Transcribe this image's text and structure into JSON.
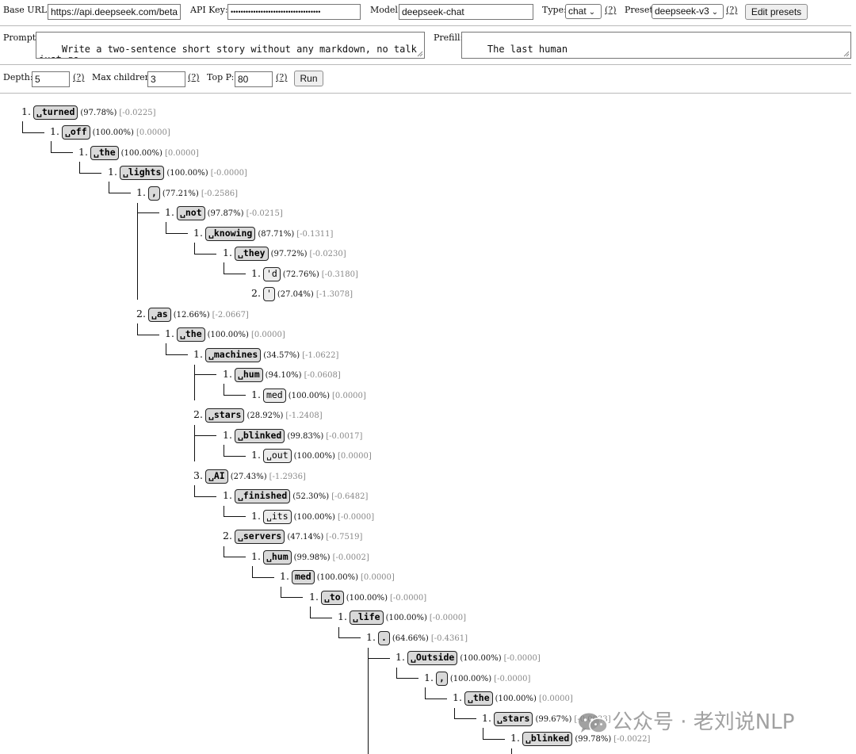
{
  "toolbar": {
    "base_url_label": "Base URL:",
    "base_url_value": "https://api.deepseek.com/beta",
    "api_key_label": "API Key:",
    "api_key_value": "••••••••••••••••••••••••••••••••••••",
    "model_label": "Model:",
    "model_value": "deepseek-chat",
    "type_label": "Type:",
    "type_value": "chat",
    "help_text": "(?)",
    "preset_label": "Preset:",
    "preset_value": "deepseek-v3",
    "edit_presets_label": "Edit presets"
  },
  "prompt_row": {
    "prompt_label": "Prompt:",
    "prompt_value": "Write a two-sentence short story without any markdown, no talk\njust go.",
    "prefill_label": "Prefill:",
    "prefill_value": "The last human"
  },
  "params": {
    "depth_label": "Depth:",
    "depth_value": "5",
    "max_children_label": "Max children:",
    "max_children_value": "3",
    "top_p_label": "Top P:",
    "top_p_value": "80",
    "help_text": "(?)",
    "run_label": "Run"
  },
  "tree": {
    "nodes": [
      {
        "rank": "1.",
        "token": "␣turned",
        "prob": "(97.78%)",
        "logprob": "[-0.0225]",
        "bold": true
      },
      {
        "rank": "1.",
        "token": "␣off",
        "prob": "(100.00%)",
        "logprob": "[0.0000]",
        "bold": true
      },
      {
        "rank": "1.",
        "token": "␣the",
        "prob": "(100.00%)",
        "logprob": "[0.0000]",
        "bold": true
      },
      {
        "rank": "1.",
        "token": "␣lights",
        "prob": "(100.00%)",
        "logprob": "[-0.0000]",
        "bold": true
      },
      {
        "rank": "1.",
        "token": ",",
        "prob": "(77.21%)",
        "logprob": "[-0.2586]",
        "bold": true
      },
      {
        "rank": "1.",
        "token": "␣not",
        "prob": "(97.87%)",
        "logprob": "[-0.0215]",
        "bold": true
      },
      {
        "rank": "1.",
        "token": "␣knowing",
        "prob": "(87.71%)",
        "logprob": "[-0.1311]",
        "bold": true
      },
      {
        "rank": "1.",
        "token": "␣they",
        "prob": "(97.72%)",
        "logprob": "[-0.0230]",
        "bold": true
      },
      {
        "rank": "1.",
        "token": "'d",
        "prob": "(72.76%)",
        "logprob": "[-0.3180]",
        "bold": false
      },
      {
        "rank": "2.",
        "token": "'",
        "prob": "(27.04%)",
        "logprob": "[-1.3078]",
        "bold": false
      },
      {
        "rank": "2.",
        "token": "␣as",
        "prob": "(12.66%)",
        "logprob": "[-2.0667]",
        "bold": true
      },
      {
        "rank": "1.",
        "token": "␣the",
        "prob": "(100.00%)",
        "logprob": "[0.0000]",
        "bold": true
      },
      {
        "rank": "1.",
        "token": "␣machines",
        "prob": "(34.57%)",
        "logprob": "[-1.0622]",
        "bold": true
      },
      {
        "rank": "1.",
        "token": "␣hum",
        "prob": "(94.10%)",
        "logprob": "[-0.0608]",
        "bold": true
      },
      {
        "rank": "1.",
        "token": "med",
        "prob": "(100.00%)",
        "logprob": "[0.0000]",
        "bold": false
      },
      {
        "rank": "2.",
        "token": "␣stars",
        "prob": "(28.92%)",
        "logprob": "[-1.2408]",
        "bold": true
      },
      {
        "rank": "1.",
        "token": "␣blinked",
        "prob": "(99.83%)",
        "logprob": "[-0.0017]",
        "bold": true
      },
      {
        "rank": "1.",
        "token": "␣out",
        "prob": "(100.00%)",
        "logprob": "[0.0000]",
        "bold": false
      },
      {
        "rank": "3.",
        "token": "␣AI",
        "prob": "(27.43%)",
        "logprob": "[-1.2936]",
        "bold": true
      },
      {
        "rank": "1.",
        "token": "␣finished",
        "prob": "(52.30%)",
        "logprob": "[-0.6482]",
        "bold": true
      },
      {
        "rank": "1.",
        "token": "␣its",
        "prob": "(100.00%)",
        "logprob": "[-0.0000]",
        "bold": false
      },
      {
        "rank": "2.",
        "token": "␣servers",
        "prob": "(47.14%)",
        "logprob": "[-0.7519]",
        "bold": true
      },
      {
        "rank": "1.",
        "token": "␣hum",
        "prob": "(99.98%)",
        "logprob": "[-0.0002]",
        "bold": true
      },
      {
        "rank": "1.",
        "token": "med",
        "prob": "(100.00%)",
        "logprob": "[0.0000]",
        "bold": true
      },
      {
        "rank": "1.",
        "token": "␣to",
        "prob": "(100.00%)",
        "logprob": "[-0.0000]",
        "bold": true
      },
      {
        "rank": "1.",
        "token": "␣life",
        "prob": "(100.00%)",
        "logprob": "[-0.0000]",
        "bold": true
      },
      {
        "rank": "1.",
        "token": ".",
        "prob": "(64.66%)",
        "logprob": "[-0.4361]",
        "bold": true
      },
      {
        "rank": "1.",
        "token": "␣Outside",
        "prob": "(100.00%)",
        "logprob": "[-0.0000]",
        "bold": true
      },
      {
        "rank": "1.",
        "token": ",",
        "prob": "(100.00%)",
        "logprob": "[-0.0000]",
        "bold": true
      },
      {
        "rank": "1.",
        "token": "␣the",
        "prob": "(100.00%)",
        "logprob": "[0.0000]",
        "bold": true
      },
      {
        "rank": "1.",
        "token": "␣stars",
        "prob": "(99.67%)",
        "logprob": "[-0.0033]",
        "bold": true
      },
      {
        "rank": "1.",
        "token": "␣blinked",
        "prob": "(99.78%)",
        "logprob": "[-0.0022]",
        "bold": true
      }
    ]
  },
  "watermark": {
    "text": "公众号 · 老刘说NLP",
    "icon": "wechat-icon"
  }
}
